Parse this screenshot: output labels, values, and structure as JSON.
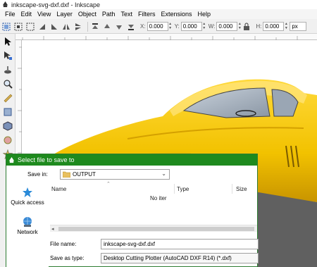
{
  "window": {
    "title": "inkscape-svg-dxf.dxf - Inkscape"
  },
  "menubar": {
    "items": [
      "File",
      "Edit",
      "View",
      "Layer",
      "Object",
      "Path",
      "Text",
      "Filters",
      "Extensions",
      "Help"
    ]
  },
  "toolbar": {
    "x_label": "X:",
    "x_value": "0.000",
    "y_label": "Y:",
    "y_value": "0.000",
    "w_label": "W:",
    "w_value": "0.000",
    "h_label": "H:",
    "h_value": "0.000",
    "unit": "px"
  },
  "dialog": {
    "title": "Select file to save to",
    "save_in_label": "Save in:",
    "save_in_value": "OUTPUT",
    "columns": {
      "name": "Name",
      "type": "Type",
      "size": "Size"
    },
    "empty_message": "No iter",
    "places": {
      "quick_access": "Quick access",
      "network": "Network"
    },
    "file_name_label": "File name:",
    "file_name_value": "inkscape-svg-dxf.dxf",
    "save_as_type_label": "Save as type:",
    "save_as_type_value": "Desktop Cutting Plotter (AutoCAD DXF R14) (*.dxf)"
  },
  "colors": {
    "dialog_titlebar": "#1e8a1e",
    "car_body": "#f2c200",
    "canvas_gray": "#606060"
  }
}
